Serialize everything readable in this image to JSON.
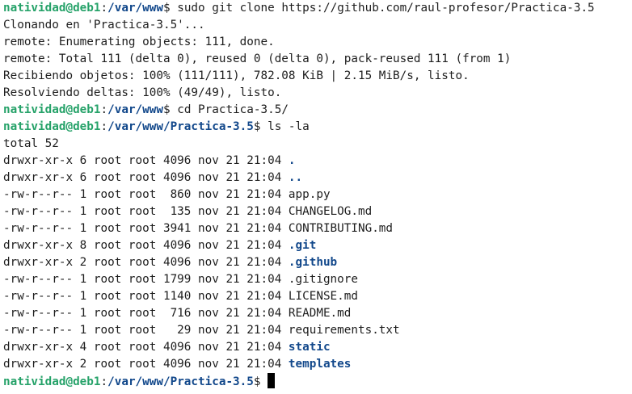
{
  "prompt": {
    "user_host": "natividad@deb1",
    "sep": ":",
    "dollar": "$"
  },
  "session": [
    {
      "type": "prompt",
      "path": "/var/www",
      "command": " sudo git clone https://github.com/raul-profesor/Practica-3.5"
    },
    {
      "type": "output",
      "text": "Clonando en 'Practica-3.5'..."
    },
    {
      "type": "output",
      "text": "remote: Enumerating objects: 111, done."
    },
    {
      "type": "output",
      "text": "remote: Total 111 (delta 0), reused 0 (delta 0), pack-reused 111 (from 1)"
    },
    {
      "type": "output",
      "text": "Recibiendo objetos: 100% (111/111), 782.08 KiB | 2.15 MiB/s, listo."
    },
    {
      "type": "output",
      "text": "Resolviendo deltas: 100% (49/49), listo."
    },
    {
      "type": "prompt",
      "path": "/var/www",
      "command": " cd Practica-3.5/"
    },
    {
      "type": "prompt",
      "path": "/var/www/Practica-3.5",
      "command": " ls -la"
    },
    {
      "type": "output",
      "text": "total 52"
    },
    {
      "type": "entry",
      "meta": "drwxr-xr-x 6 root root 4096 nov 21 21:04 ",
      "name": ".",
      "is_dir": true
    },
    {
      "type": "entry",
      "meta": "drwxr-xr-x 6 root root 4096 nov 21 21:04 ",
      "name": "..",
      "is_dir": true
    },
    {
      "type": "entry",
      "meta": "-rw-r--r-- 1 root root  860 nov 21 21:04 ",
      "name": "app.py",
      "is_dir": false
    },
    {
      "type": "entry",
      "meta": "-rw-r--r-- 1 root root  135 nov 21 21:04 ",
      "name": "CHANGELOG.md",
      "is_dir": false
    },
    {
      "type": "entry",
      "meta": "-rw-r--r-- 1 root root 3941 nov 21 21:04 ",
      "name": "CONTRIBUTING.md",
      "is_dir": false
    },
    {
      "type": "entry",
      "meta": "drwxr-xr-x 8 root root 4096 nov 21 21:04 ",
      "name": ".git",
      "is_dir": true
    },
    {
      "type": "entry",
      "meta": "drwxr-xr-x 2 root root 4096 nov 21 21:04 ",
      "name": ".github",
      "is_dir": true
    },
    {
      "type": "entry",
      "meta": "-rw-r--r-- 1 root root 1799 nov 21 21:04 ",
      "name": ".gitignore",
      "is_dir": false
    },
    {
      "type": "entry",
      "meta": "-rw-r--r-- 1 root root 1140 nov 21 21:04 ",
      "name": "LICENSE.md",
      "is_dir": false
    },
    {
      "type": "entry",
      "meta": "-rw-r--r-- 1 root root  716 nov 21 21:04 ",
      "name": "README.md",
      "is_dir": false
    },
    {
      "type": "entry",
      "meta": "-rw-r--r-- 1 root root   29 nov 21 21:04 ",
      "name": "requirements.txt",
      "is_dir": false
    },
    {
      "type": "entry",
      "meta": "drwxr-xr-x 4 root root 4096 nov 21 21:04 ",
      "name": "static",
      "is_dir": true
    },
    {
      "type": "entry",
      "meta": "drwxr-xr-x 2 root root 4096 nov 21 21:04 ",
      "name": "templates",
      "is_dir": true
    },
    {
      "type": "prompt",
      "path": "/var/www/Practica-3.5",
      "command": " ",
      "cursor": true
    }
  ],
  "colors": {
    "background": "#ffffff",
    "foreground": "#1e1e1e",
    "user_host": "#26a269",
    "path": "#12488b",
    "directory": "#12488b",
    "cursor": "#000000"
  }
}
